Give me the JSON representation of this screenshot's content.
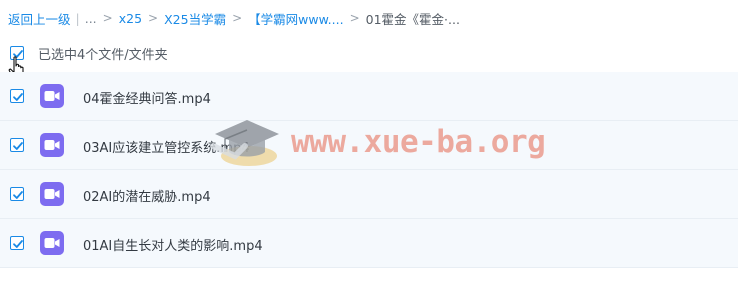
{
  "breadcrumb": {
    "back_label": "返回上一级",
    "pipe": "|",
    "ellipsis": "...",
    "sep": ">",
    "items": [
      "x25",
      "X25当学霸",
      "【学霸网www....",
      "01霍金《霍金·..."
    ]
  },
  "selection": {
    "label": "已选中4个文件/文件夹",
    "all_checked": true
  },
  "files": [
    {
      "name": "04霍金经典问答.mp4",
      "checked": true,
      "type": "video"
    },
    {
      "name": "03AI应该建立管控系统.mp4",
      "checked": true,
      "type": "video"
    },
    {
      "name": "02AI的潜在威胁.mp4",
      "checked": true,
      "type": "video"
    },
    {
      "name": "01AI自生长对人类的影响.mp4",
      "checked": true,
      "type": "video"
    }
  ],
  "watermark": {
    "text": "www.xue-ba.org"
  },
  "colors": {
    "accent": "#1a8ae6",
    "video_icon": "#7d6cf0",
    "row_bg": "#f5f9fd"
  }
}
